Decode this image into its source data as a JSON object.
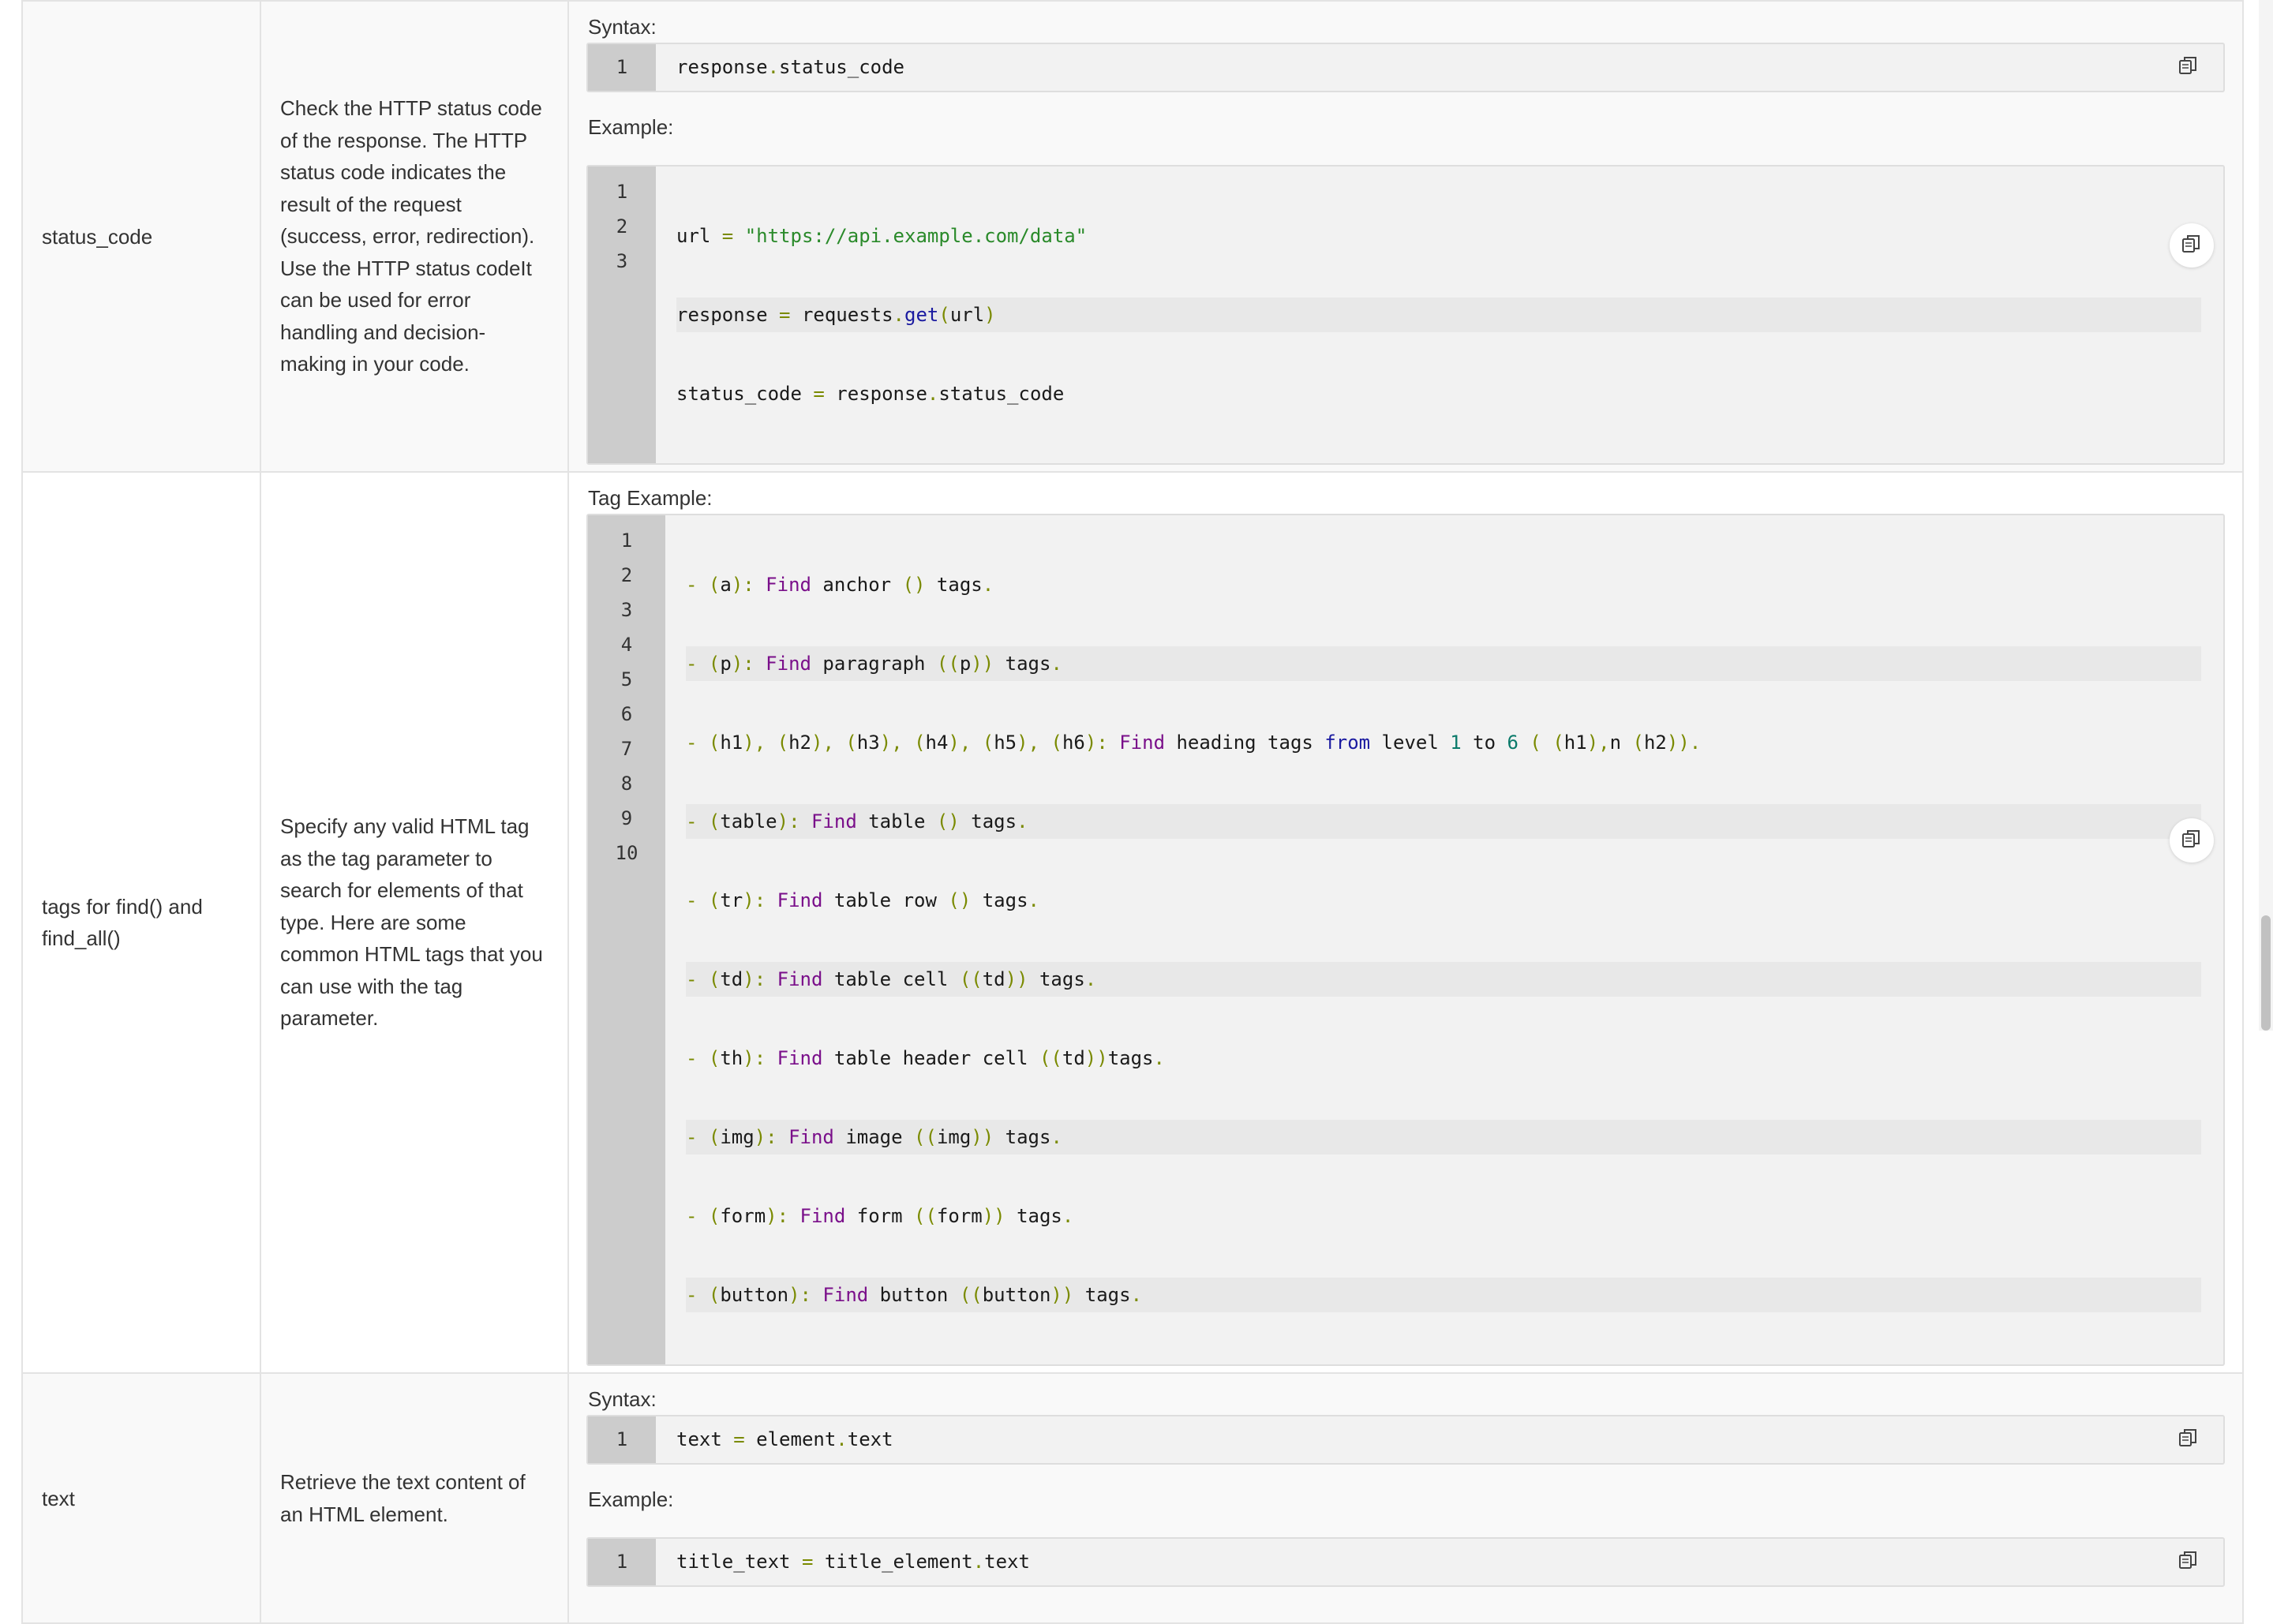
{
  "labels": {
    "syntax": "Syntax:",
    "example": "Example:",
    "tag_example": "Tag Example:"
  },
  "rows": [
    {
      "name": "status_code",
      "description": "Check the HTTP status code of the response. The HTTP status code indicates the result of the request (success, error, redirection). Use the HTTP status codeIt can be used for error handling and decision-making in your code.",
      "syntax_line": "response.status_code",
      "example_lines": [
        "url = \"https://api.example.com/data\"",
        "response = requests.get(url)",
        "status_code = response.status_code"
      ]
    },
    {
      "name": "tags for find() and find_all()",
      "description": "Specify any valid HTML tag as the tag parameter to search for elements of that type. Here are some common HTML tags that you can use with the tag parameter.",
      "tag_lines": [
        "- (a): Find anchor () tags.",
        "- (p): Find paragraph ((p)) tags.",
        "- (h1), (h2), (h3), (h4), (h5), (h6): Find heading tags from level 1 to 6 ( (h1),n (h2)).",
        "- (table): Find table () tags.",
        "- (tr): Find table row () tags.",
        "- (td): Find table cell ((td)) tags.",
        "- (th): Find table header cell ((td))tags.",
        "- (img): Find image ((img)) tags.",
        "- (form): Find form ((form)) tags.",
        "- (button): Find button ((button)) tags."
      ]
    },
    {
      "name": "text",
      "description": "Retrieve the text content of an HTML element.",
      "syntax_line": "text = element.text",
      "example_lines": [
        "title_text = title_element.text"
      ]
    }
  ],
  "icons": {
    "copy": "copy-icon"
  }
}
